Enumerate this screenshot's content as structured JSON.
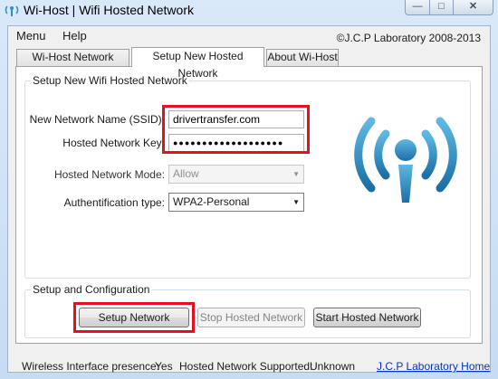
{
  "window": {
    "title": "Wi-Host | Wifi Hosted Network",
    "minimize_glyph": "—",
    "maximize_glyph": "□",
    "close_glyph": "✕"
  },
  "menu": {
    "items": [
      "Menu",
      "Help"
    ],
    "copyright": "©J.C.P Laboratory 2008-2013"
  },
  "tabs": [
    {
      "label": "Wi-Host Network Status",
      "active": false
    },
    {
      "label": "Setup New Hosted Network",
      "active": true
    },
    {
      "label": "About Wi-Host",
      "active": false
    }
  ],
  "setup": {
    "group_title": "Setup New Wifi Hosted Network",
    "ssid_label": "New Network Name (SSID):",
    "ssid_value": "drivertransfer.com",
    "key_label": "Hosted Network Key:",
    "key_value": "●●●●●●●●●●●●●●●●●●●",
    "mode_label": "Hosted Network Mode:",
    "mode_value": "Allow",
    "auth_label": "Authentification type:",
    "auth_value": "WPA2-Personal",
    "highlight_color": "#e8101f"
  },
  "config": {
    "group_title": "Setup and Configuration",
    "setup_button": "Setup Network",
    "stop_button": "Stop Hosted Network",
    "start_button": "Start Hosted Network"
  },
  "status": {
    "wireless_label": "Wireless Interface presence:",
    "wireless_value": "Yes",
    "supported_label": "Hosted Network Supported:",
    "supported_value": "Unknown",
    "home_link": "J.C.P Laboratory Home"
  },
  "icons": {
    "app": "wifi-antenna-icon",
    "logo": "wifi-hotspot-logo-icon",
    "accent": "#2a8fc4"
  }
}
